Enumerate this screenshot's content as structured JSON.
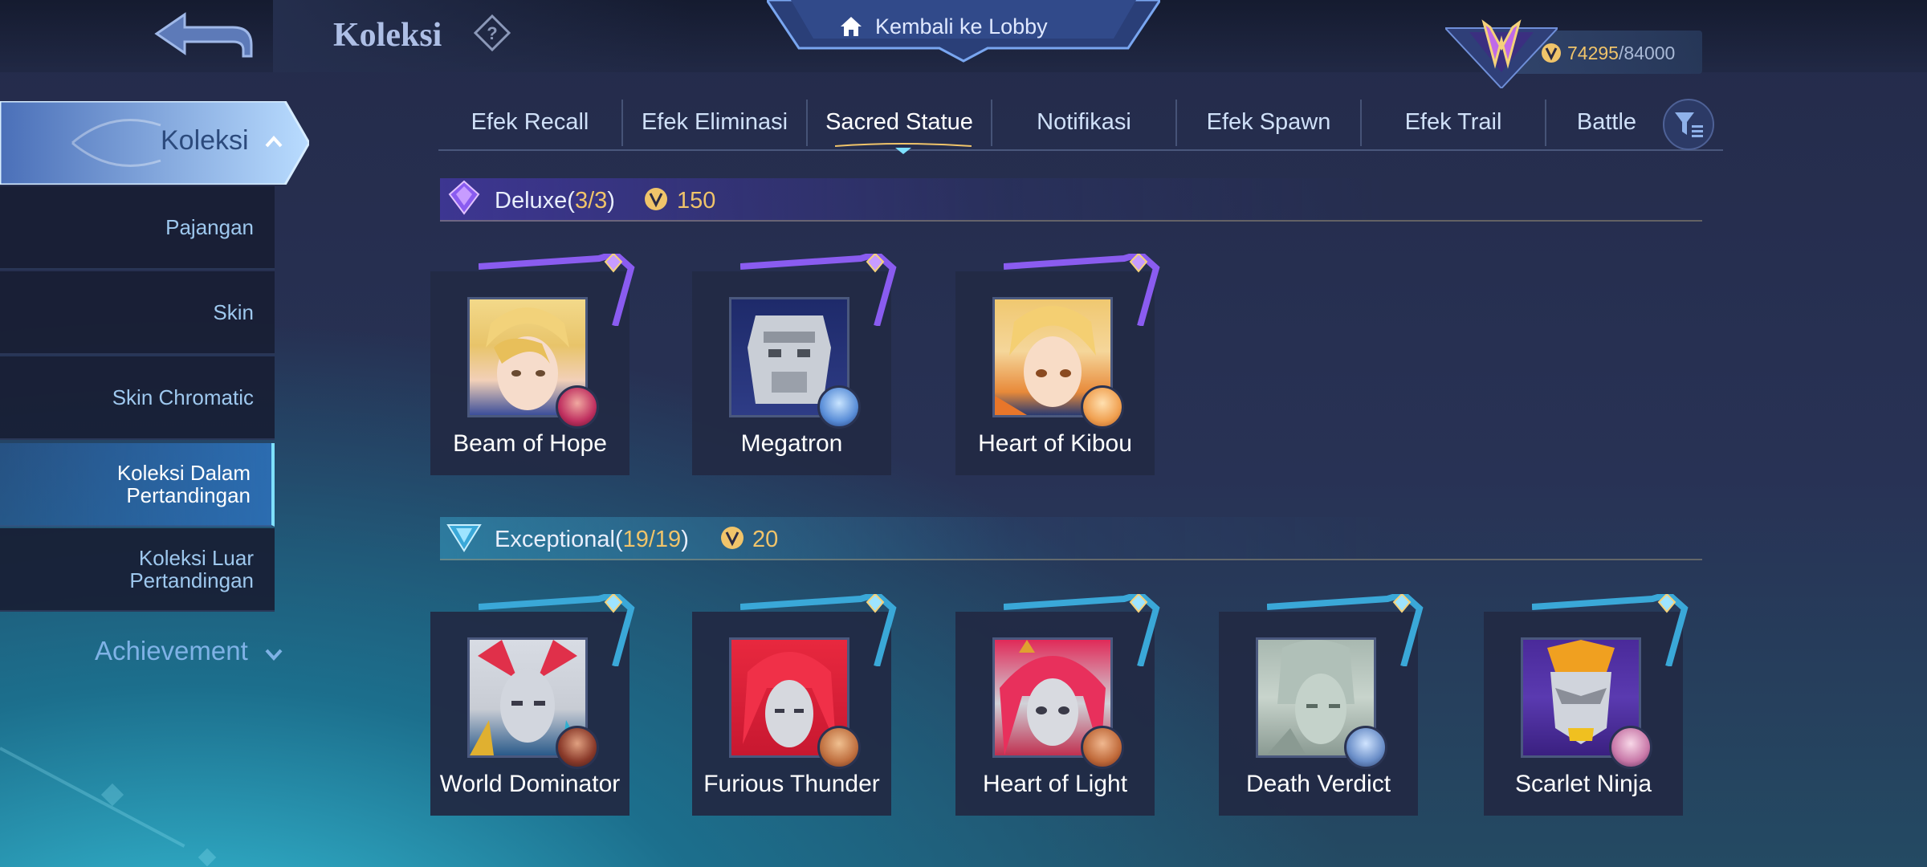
{
  "header": {
    "title": "Koleksi",
    "lobby_label": "Kembali ke Lobby",
    "points_current": "74295",
    "points_max": "/84000"
  },
  "sidebar": {
    "main_label": "Koleksi",
    "items": [
      {
        "label": "Pajangan"
      },
      {
        "label": "Skin"
      },
      {
        "label": "Skin Chromatic"
      },
      {
        "label": "Koleksi Dalam\nPertandingan",
        "active": true
      },
      {
        "label": "Koleksi Luar\nPertandingan"
      }
    ],
    "achievement_label": "Achievement"
  },
  "tabs": [
    "Efek Recall",
    "Efek Eliminasi",
    "Sacred Statue",
    "Notifikasi",
    "Efek Spawn",
    "Efek Trail",
    "Battle"
  ],
  "active_tab": "Sacred Statue",
  "sections": {
    "deluxe": {
      "title": "Deluxe",
      "count_open": "(",
      "count": "3/3",
      "count_close": ")",
      "points": "150",
      "items": [
        {
          "name": "Beam of Hope"
        },
        {
          "name": "Megatron"
        },
        {
          "name": "Heart of Kibou"
        }
      ]
    },
    "exceptional": {
      "title": "Exceptional",
      "count_open": "(",
      "count": "19/19",
      "count_close": ")",
      "points": "20",
      "items": [
        {
          "name": "World Dominator"
        },
        {
          "name": "Furious Thunder"
        },
        {
          "name": "Heart of Light"
        },
        {
          "name": "Death Verdict"
        },
        {
          "name": "Scarlet Ninja"
        }
      ]
    }
  },
  "colors": {
    "accent_gold": "#f0c46a",
    "deluxe_purple": "#7a4fe0",
    "exceptional_cyan": "#4fc3e8"
  }
}
